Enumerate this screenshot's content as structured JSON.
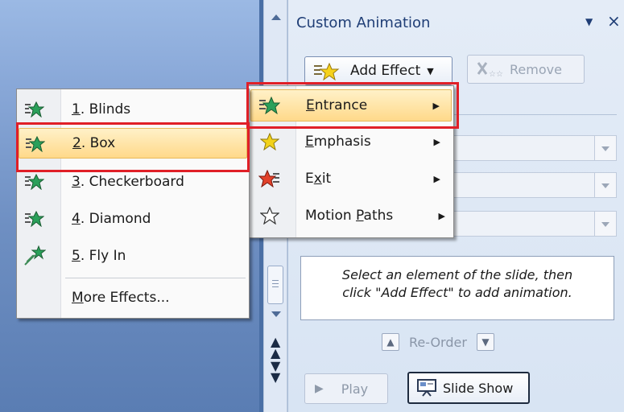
{
  "pane": {
    "title": "Custom Animation",
    "add_effect_label": "Add Effect",
    "remove_label": "Remove",
    "hint_line1": "Select an element of the slide, then",
    "hint_line2": "click \"Add Effect\" to add animation.",
    "reorder_label": "Re-Order",
    "play_label": "Play",
    "slideshow_label": "Slide Show"
  },
  "effect_menu": {
    "items": [
      {
        "pre": "",
        "key": "E",
        "post": "ntrance"
      },
      {
        "pre": "",
        "key": "E",
        "post": "mphasis"
      },
      {
        "pre": "E",
        "key": "x",
        "post": "it"
      },
      {
        "pre": "Motion ",
        "key": "P",
        "post": "aths"
      }
    ]
  },
  "entrance_menu": {
    "items": [
      {
        "key": "1",
        "rest": ". Blinds"
      },
      {
        "key": "2",
        "rest": ". Box"
      },
      {
        "key": "3",
        "rest": ". Checkerboard"
      },
      {
        "key": "4",
        "rest": ". Diamond"
      },
      {
        "key": "5",
        "rest": ". Fly In"
      }
    ],
    "more_key": "M",
    "more_rest": "ore Effects..."
  },
  "colors": {
    "highlight_outline": "#e01f27",
    "menu_highlight": "#ffd98a"
  }
}
